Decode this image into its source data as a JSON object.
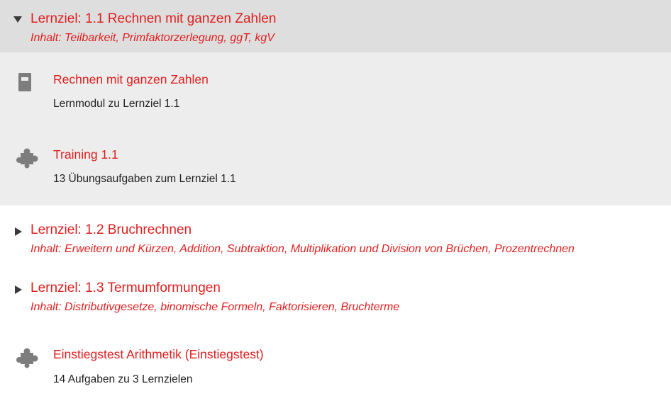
{
  "sections": [
    {
      "title": "Lernziel: 1.1 Rechnen mit ganzen Zahlen",
      "content": "Inhalt: Teilbarkeit, Primfaktorzerlegung, ggT, kgV",
      "expanded": true,
      "items": [
        {
          "icon": "book-icon",
          "title": "Rechnen mit ganzen Zahlen",
          "description": "Lernmodul zu Lernziel 1.1"
        },
        {
          "icon": "puzzle-icon",
          "title": "Training 1.1",
          "description": "13 Übungsaufgaben zum Lernziel 1.1"
        }
      ]
    },
    {
      "title": "Lernziel: 1.2 Bruchrechnen",
      "content": "Inhalt: Erweitern und Kürzen, Addition, Subtraktion, Multiplikation und Division von Brüchen, Prozentrechnen",
      "expanded": false
    },
    {
      "title": "Lernziel: 1.3 Termumformungen",
      "content": "Inhalt: Distributivgesetze, binomische Formeln, Faktorisieren, Bruchterme",
      "expanded": false
    }
  ],
  "test_item": {
    "icon": "puzzle-icon",
    "title": "Einstiegstest Arithmetik (Einstiegstest)",
    "description": "14 Aufgaben zu 3 Lernzielen"
  },
  "colors": {
    "link": "#e01e1e",
    "header_bg": "#dedede",
    "body_bg": "#ededed",
    "icon": "#7d7d7d"
  }
}
